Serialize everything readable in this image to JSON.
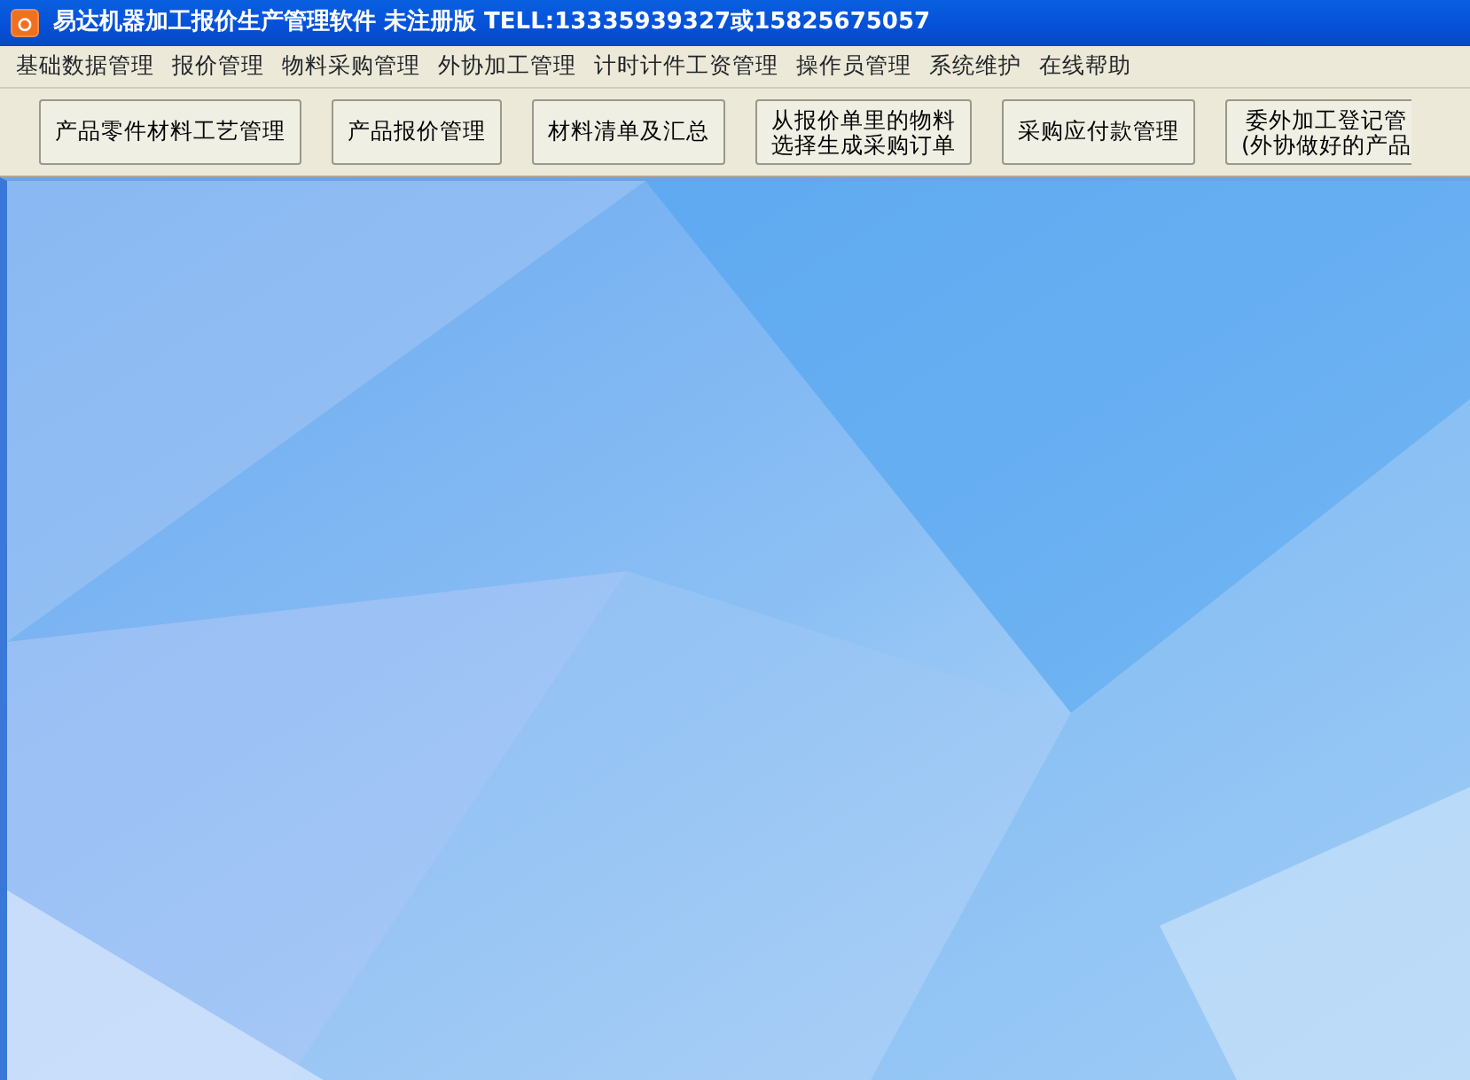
{
  "window": {
    "title": "易达机器加工报价生产管理软件  未注册版  TELL:13335939327或15825675057"
  },
  "menu": [
    "基础数据管理",
    "报价管理",
    "物料采购管理",
    "外协加工管理",
    "计时计件工资管理",
    "操作员管理",
    "系统维护",
    "在线帮助"
  ],
  "toolbar": [
    {
      "lines": [
        "产品零件材料工艺管理"
      ]
    },
    {
      "lines": [
        "产品报价管理"
      ]
    },
    {
      "lines": [
        "材料清单及汇总"
      ]
    },
    {
      "lines": [
        "从报价单里的物料",
        "选择生成采购订单"
      ]
    },
    {
      "lines": [
        "采购应付款管理"
      ]
    },
    {
      "lines": [
        "委外加工登记管",
        "(外协做好的产品"
      ]
    }
  ]
}
